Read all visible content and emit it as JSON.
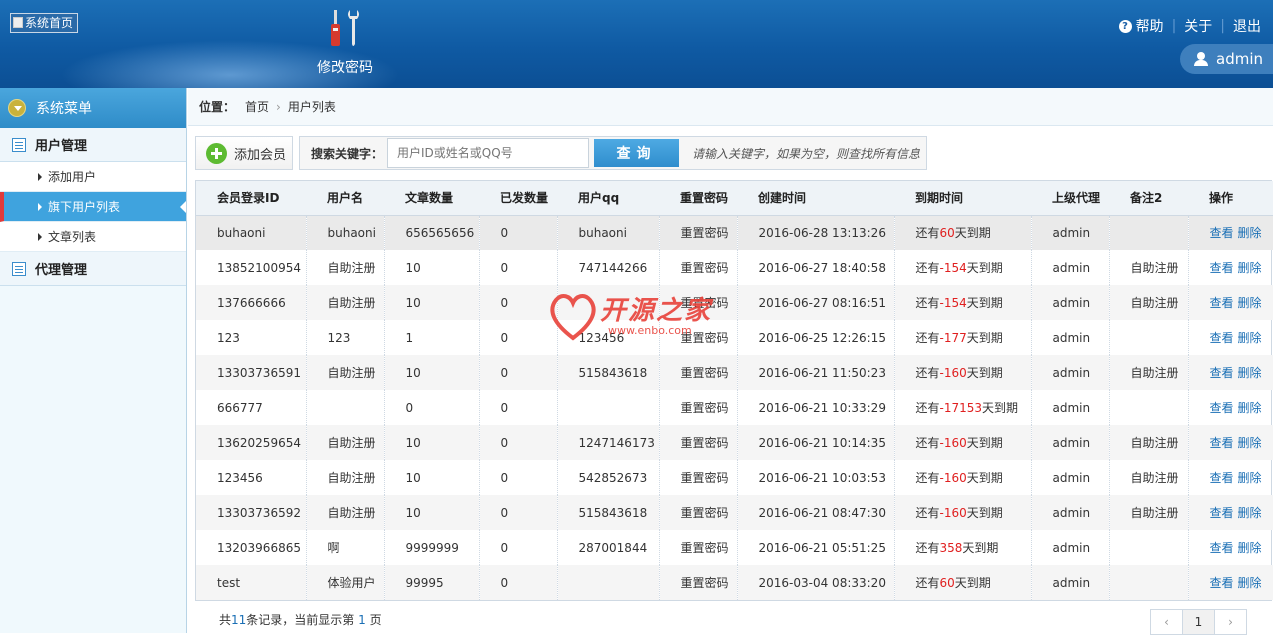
{
  "header": {
    "logo_alt": "系统首页",
    "tool_label": "修改密码",
    "help": "帮助",
    "about": "关于",
    "logout": "退出",
    "user": "admin"
  },
  "sidebar": {
    "title": "系统菜单",
    "group1": "用户管理",
    "items": [
      {
        "label": "添加用户"
      },
      {
        "label": "旗下用户列表"
      },
      {
        "label": "文章列表"
      }
    ],
    "group2": "代理管理"
  },
  "breadcrumb": {
    "label": "位置：",
    "home": "首页",
    "current": "用户列表"
  },
  "toolbar": {
    "add_label": "添加会员",
    "search_label": "搜索关键字：",
    "search_placeholder": "用户ID或姓名或QQ号",
    "search_button": "查询",
    "hint": "请输入关键字，如果为空，则查找所有信息"
  },
  "table": {
    "columns": [
      "会员登录ID",
      "用户名",
      "文章数量",
      "已发数量",
      "用户qq",
      "重置密码",
      "创建时间",
      "到期时间",
      "上级代理",
      "备注2",
      "操作"
    ],
    "rows": [
      {
        "id": "buhaoni",
        "name": "buhaoni",
        "articles": "656565656",
        "sent": "0",
        "qq": "buhaoni",
        "reset": "重置密码",
        "created": "2016-06-28 13:13:26",
        "exp_pre": "还有",
        "exp_days": "60",
        "exp_post": "天到期",
        "agent": "admin",
        "remark": "",
        "view": "查看",
        "del": "删除"
      },
      {
        "id": "13852100954",
        "name": "自助注册",
        "articles": "10",
        "sent": "0",
        "qq": "747144266",
        "reset": "重置密码",
        "created": "2016-06-27 18:40:58",
        "exp_pre": "还有",
        "exp_days": "-154",
        "exp_post": "天到期",
        "agent": "admin",
        "remark": "自助注册",
        "view": "查看",
        "del": "删除"
      },
      {
        "id": "137666666",
        "name": "自助注册",
        "articles": "10",
        "sent": "0",
        "qq": "",
        "reset": "重置密码",
        "created": "2016-06-27 08:16:51",
        "exp_pre": "还有",
        "exp_days": "-154",
        "exp_post": "天到期",
        "agent": "admin",
        "remark": "自助注册",
        "view": "查看",
        "del": "删除"
      },
      {
        "id": "123",
        "name": "123",
        "articles": "1",
        "sent": "0",
        "qq": "123456",
        "reset": "重置密码",
        "created": "2016-06-25 12:26:15",
        "exp_pre": "还有",
        "exp_days": "-177",
        "exp_post": "天到期",
        "agent": "admin",
        "remark": "",
        "view": "查看",
        "del": "删除"
      },
      {
        "id": "13303736591",
        "name": "自助注册",
        "articles": "10",
        "sent": "0",
        "qq": "515843618",
        "reset": "重置密码",
        "created": "2016-06-21 11:50:23",
        "exp_pre": "还有",
        "exp_days": "-160",
        "exp_post": "天到期",
        "agent": "admin",
        "remark": "自助注册",
        "view": "查看",
        "del": "删除"
      },
      {
        "id": "666777",
        "name": "",
        "articles": "0",
        "sent": "0",
        "qq": "",
        "reset": "重置密码",
        "created": "2016-06-21 10:33:29",
        "exp_pre": "还有",
        "exp_days": "-17153",
        "exp_post": "天到期",
        "agent": "admin",
        "remark": "",
        "view": "查看",
        "del": "删除"
      },
      {
        "id": "13620259654",
        "name": "自助注册",
        "articles": "10",
        "sent": "0",
        "qq": "1247146173",
        "reset": "重置密码",
        "created": "2016-06-21 10:14:35",
        "exp_pre": "还有",
        "exp_days": "-160",
        "exp_post": "天到期",
        "agent": "admin",
        "remark": "自助注册",
        "view": "查看",
        "del": "删除"
      },
      {
        "id": "123456",
        "name": "自助注册",
        "articles": "10",
        "sent": "0",
        "qq": "542852673",
        "reset": "重置密码",
        "created": "2016-06-21 10:03:53",
        "exp_pre": "还有",
        "exp_days": "-160",
        "exp_post": "天到期",
        "agent": "admin",
        "remark": "自助注册",
        "view": "查看",
        "del": "删除"
      },
      {
        "id": "13303736592",
        "name": "自助注册",
        "articles": "10",
        "sent": "0",
        "qq": "515843618",
        "reset": "重置密码",
        "created": "2016-06-21 08:47:30",
        "exp_pre": "还有",
        "exp_days": "-160",
        "exp_post": "天到期",
        "agent": "admin",
        "remark": "自助注册",
        "view": "查看",
        "del": "删除"
      },
      {
        "id": "13203966865",
        "name": "啊",
        "articles": "9999999",
        "sent": "0",
        "qq": "287001844",
        "reset": "重置密码",
        "created": "2016-06-21 05:51:25",
        "exp_pre": "还有",
        "exp_days": "358",
        "exp_post": "天到期",
        "agent": "admin",
        "remark": "",
        "view": "查看",
        "del": "删除"
      },
      {
        "id": "test",
        "name": "体验用户",
        "articles": "99995",
        "sent": "0",
        "qq": "",
        "reset": "重置密码",
        "created": "2016-03-04 08:33:20",
        "exp_pre": "还有",
        "exp_days": "60",
        "exp_post": "天到期",
        "agent": "admin",
        "remark": "",
        "view": "查看",
        "del": "删除"
      }
    ]
  },
  "footer": {
    "pre": "共",
    "count": "11",
    "mid": "条记录，当前显示第",
    "page": "1",
    "post": "页"
  },
  "pager": {
    "prev": "‹",
    "current": "1",
    "next": "›"
  },
  "watermark": {
    "text": "开源之家",
    "url": "www.enbo.com"
  }
}
